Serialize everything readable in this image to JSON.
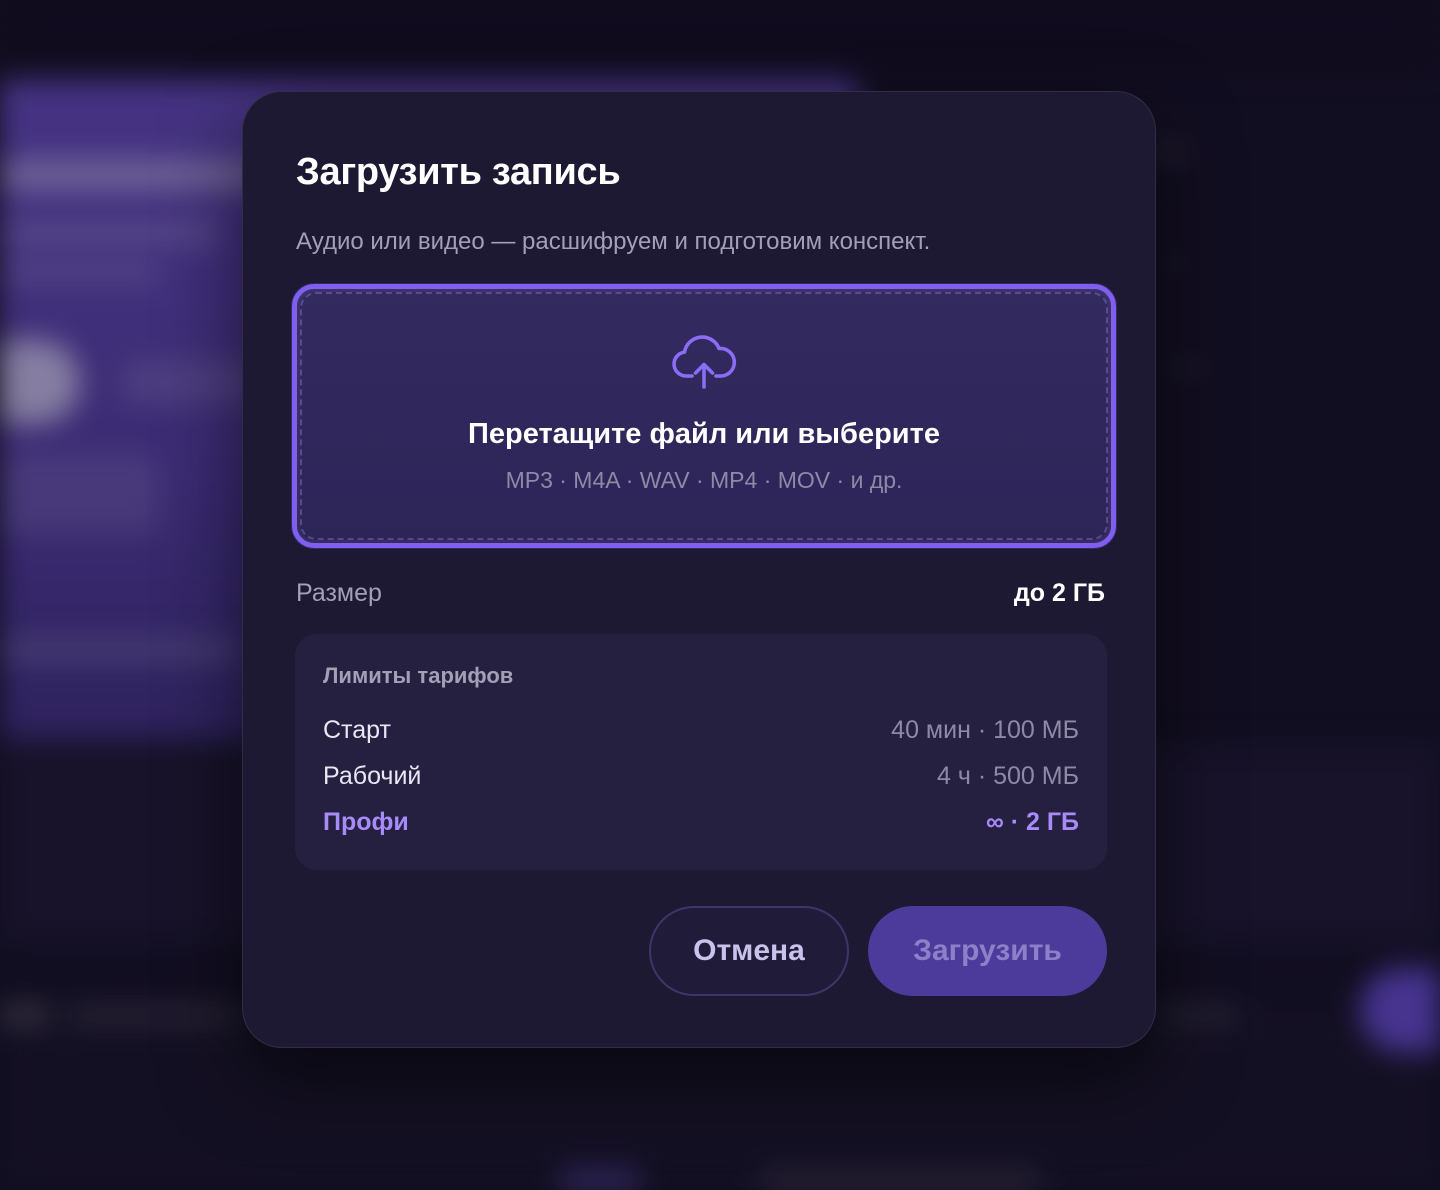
{
  "modal": {
    "title": "Загрузить запись",
    "subtitle": "Аудио или видео — расшифруем и подготовим конспект."
  },
  "dropzone": {
    "icon": "cloud-upload-icon",
    "title": "Перетащите файл или выберите",
    "formats": "MP3 · M4A · WAV · MP4 · MOV · и др."
  },
  "size": {
    "label": "Размер",
    "value": "до 2 ГБ"
  },
  "limits": {
    "title": "Лимиты тарифов",
    "plans": [
      {
        "name": "Старт",
        "value": "40 мин · 100 МБ"
      },
      {
        "name": "Рабочий",
        "value": "4 ч · 500 МБ"
      },
      {
        "name": "Профи",
        "value": "∞ · 2 ГБ"
      }
    ]
  },
  "buttons": {
    "cancel": "Отмена",
    "upload": "Загрузить"
  },
  "colors": {
    "accent": "#7e5ff0",
    "highlight": "#a78bfa",
    "modal_bg": "#1d1933"
  }
}
